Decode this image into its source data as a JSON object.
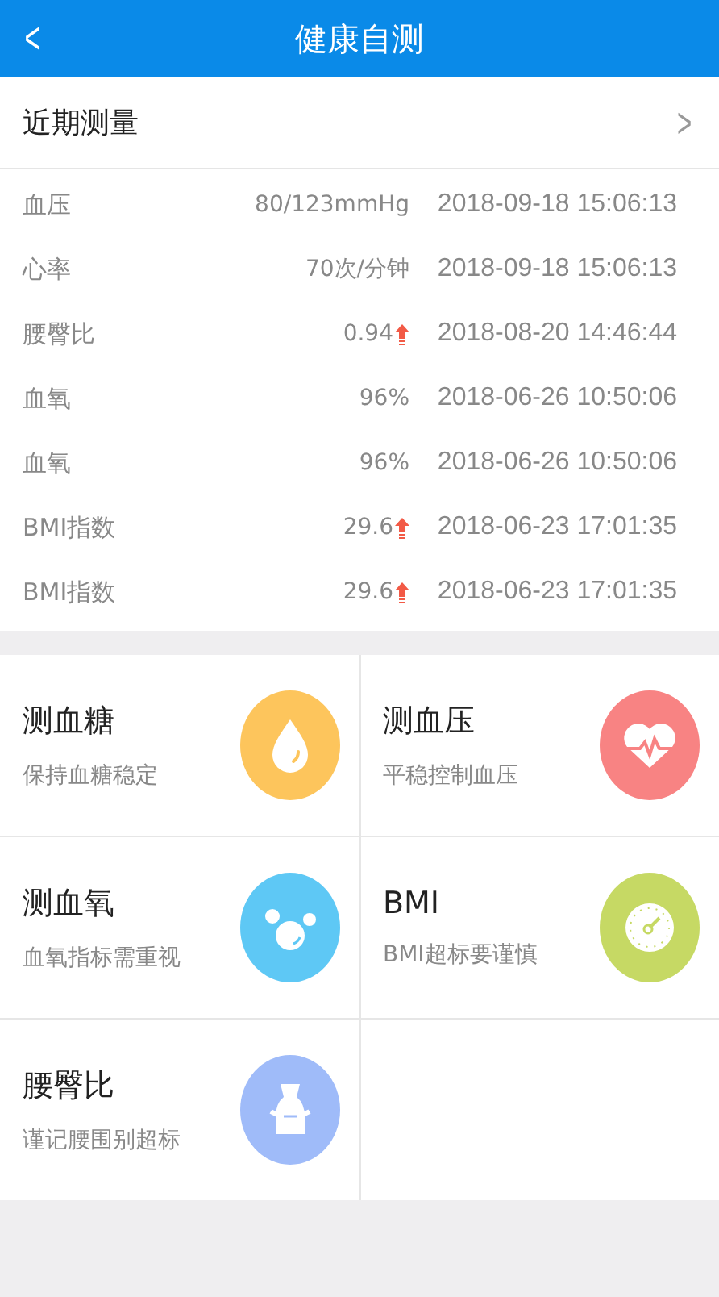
{
  "header": {
    "back": "<",
    "title": "健康自测"
  },
  "recent": {
    "title": "近期测量",
    "chevron": ">",
    "rows": [
      {
        "name": "血压",
        "value": "80/123mmHg",
        "rising": false,
        "time": "2018-09-18 15:06:13"
      },
      {
        "name": "心率",
        "value": "70次/分钟",
        "rising": false,
        "time": "2018-09-18 15:06:13"
      },
      {
        "name": "腰臀比",
        "value": "0.94",
        "rising": true,
        "time": "2018-08-20 14:46:44"
      },
      {
        "name": "血氧",
        "value": "96%",
        "rising": false,
        "time": "2018-06-26 10:50:06"
      },
      {
        "name": "血氧",
        "value": "96%",
        "rising": false,
        "time": "2018-06-26 10:50:06"
      },
      {
        "name": "BMI指数",
        "value": "29.6",
        "rising": true,
        "time": "2018-06-23 17:01:35"
      },
      {
        "name": "BMI指数",
        "value": "29.6",
        "rising": true,
        "time": "2018-06-23 17:01:35"
      }
    ]
  },
  "tiles": [
    {
      "title": "测血糖",
      "subtitle": "保持血糖稳定",
      "kind": "drop",
      "color": "#fdc55c"
    },
    {
      "title": "测血压",
      "subtitle": "平稳控制血压",
      "kind": "heart",
      "color": "#f88383"
    },
    {
      "title": "测血氧",
      "subtitle": "血氧指标需重视",
      "kind": "bubbles",
      "color": "#5ec8f5"
    },
    {
      "title": "BMI",
      "subtitle": "BMI超标要谨慎",
      "kind": "gauge",
      "color": "#c6d964"
    },
    {
      "title": "腰臀比",
      "subtitle": "谨记腰围别超标",
      "kind": "vase",
      "color": "#9fbbf9"
    }
  ]
}
